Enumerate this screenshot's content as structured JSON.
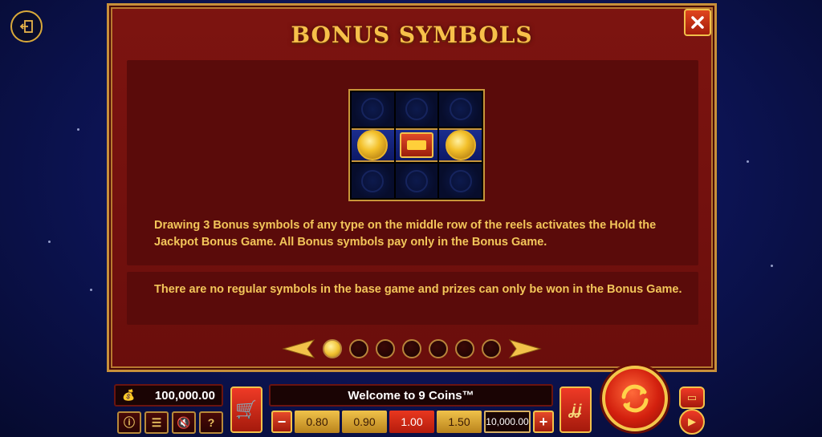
{
  "panel": {
    "title": "BONUS SYMBOLS",
    "description_1": "Drawing 3 Bonus symbols of any type on the middle row of the reels activates the Hold the Jackpot Bonus Game. All Bonus symbols pay only in the Bonus Game.",
    "description_2": "There are no regular symbols in the base game and prizes can only be won in the Bonus Game.",
    "page_count": 7,
    "current_page": 1
  },
  "hud": {
    "balance": "100,000.00",
    "welcome": "Welcome to 9 Coins™",
    "bets": [
      "0.80",
      "0.90",
      "1.00",
      "1.50"
    ],
    "selected_bet": "1.00",
    "max_bet": "10,000.00",
    "minus": "−",
    "plus": "+",
    "help": "?",
    "turbo": "ʝʝ"
  },
  "colors": {
    "accent_gold": "#f3c65a",
    "panel_red": "#7d1410",
    "button_red": "#d3200e"
  }
}
